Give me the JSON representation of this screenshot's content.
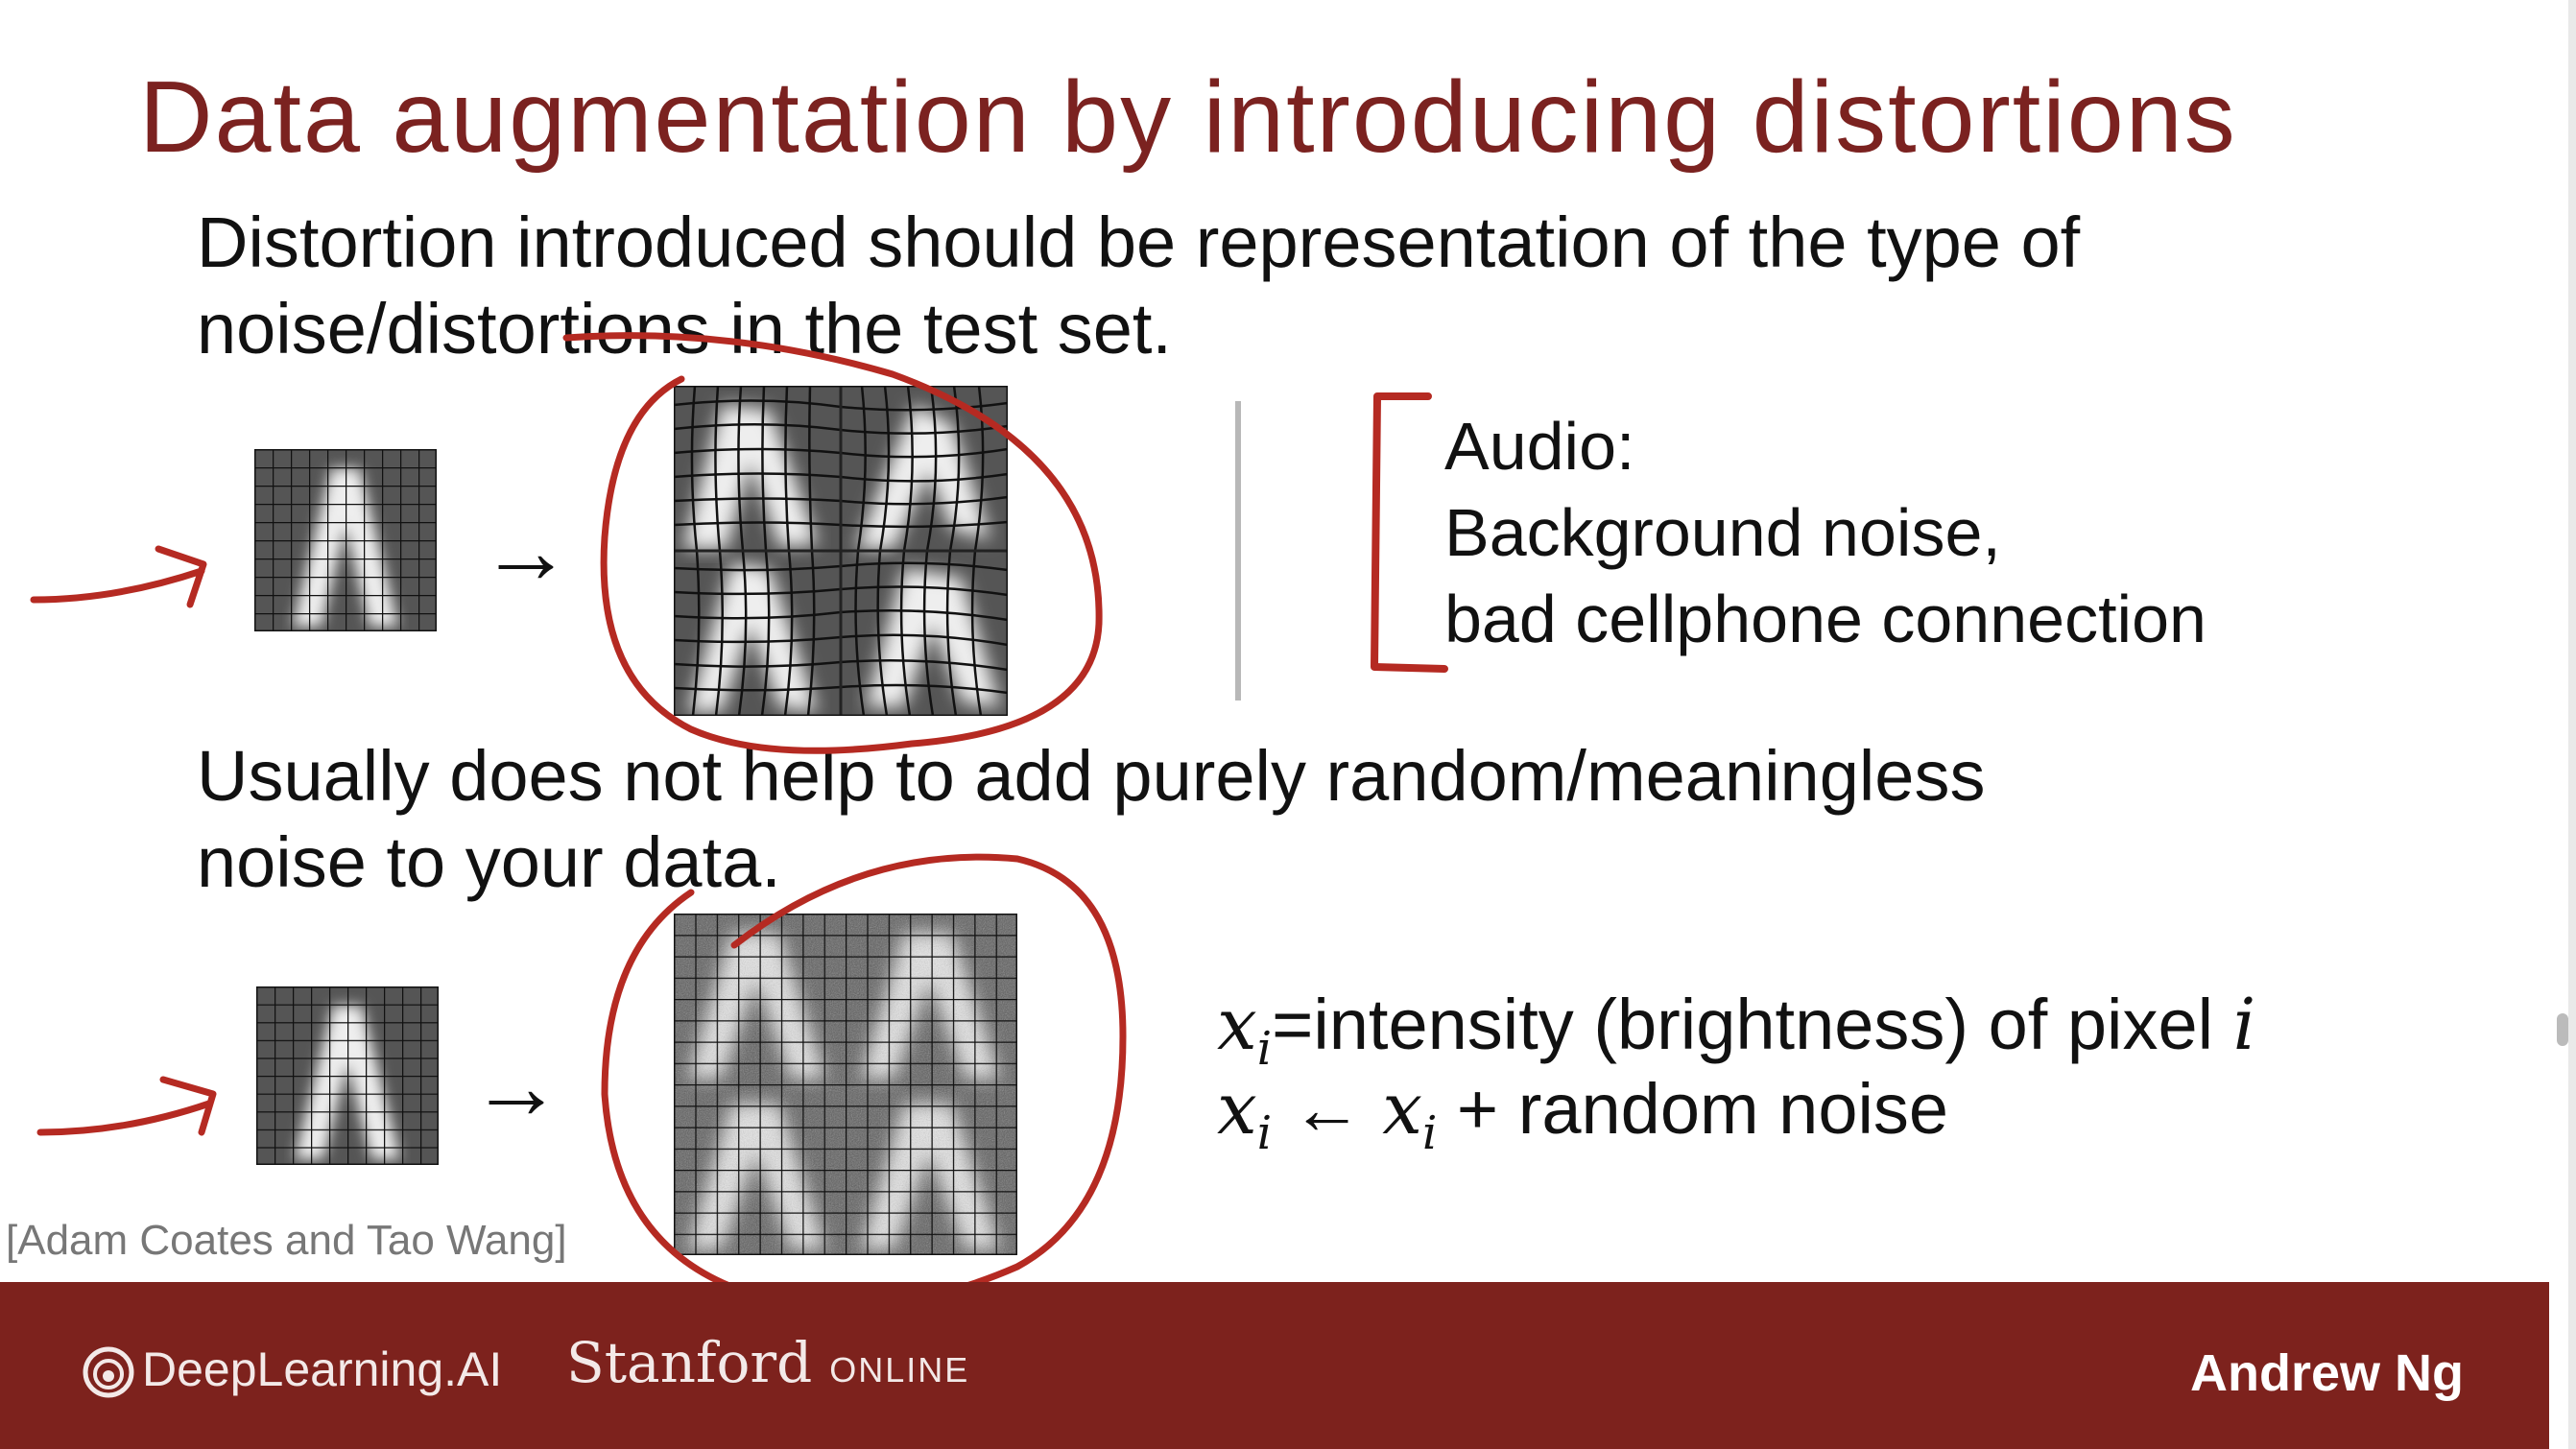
{
  "slide": {
    "title": "Data augmentation by introducing distortions",
    "paragraph1_line1": "Distortion introduced should be representation of the type of",
    "paragraph1_line2": "noise/distortions in the test set.",
    "audio_line1": "Audio:",
    "audio_line2": "Background noise,",
    "audio_line3": "bad cellphone connection",
    "paragraph2_line1": "Usually does not help to add purely random/meaningless",
    "paragraph2_line2": "noise to your data.",
    "math1_var": "x",
    "math1_sub": "i",
    "math1_text": "=intensity (brightness) of pixel ",
    "math1_end": "i",
    "math2_var": "x",
    "math2_sub": "i",
    "math2_arrow": " ← ",
    "math2_var2": "x",
    "math2_sub2": "i",
    "math2_text": " + random noise",
    "credit": "[Adam Coates and Tao Wang]"
  },
  "footer": {
    "logo_deeplearning": "DeepLearning.AI",
    "logo_stanford": "Stanford",
    "logo_stanford_online": "ONLINE",
    "author": "Andrew Ng"
  },
  "colors": {
    "title": "#7b2220",
    "footer_bg": "#7d221d",
    "annotation_ink": "#b52a22"
  }
}
